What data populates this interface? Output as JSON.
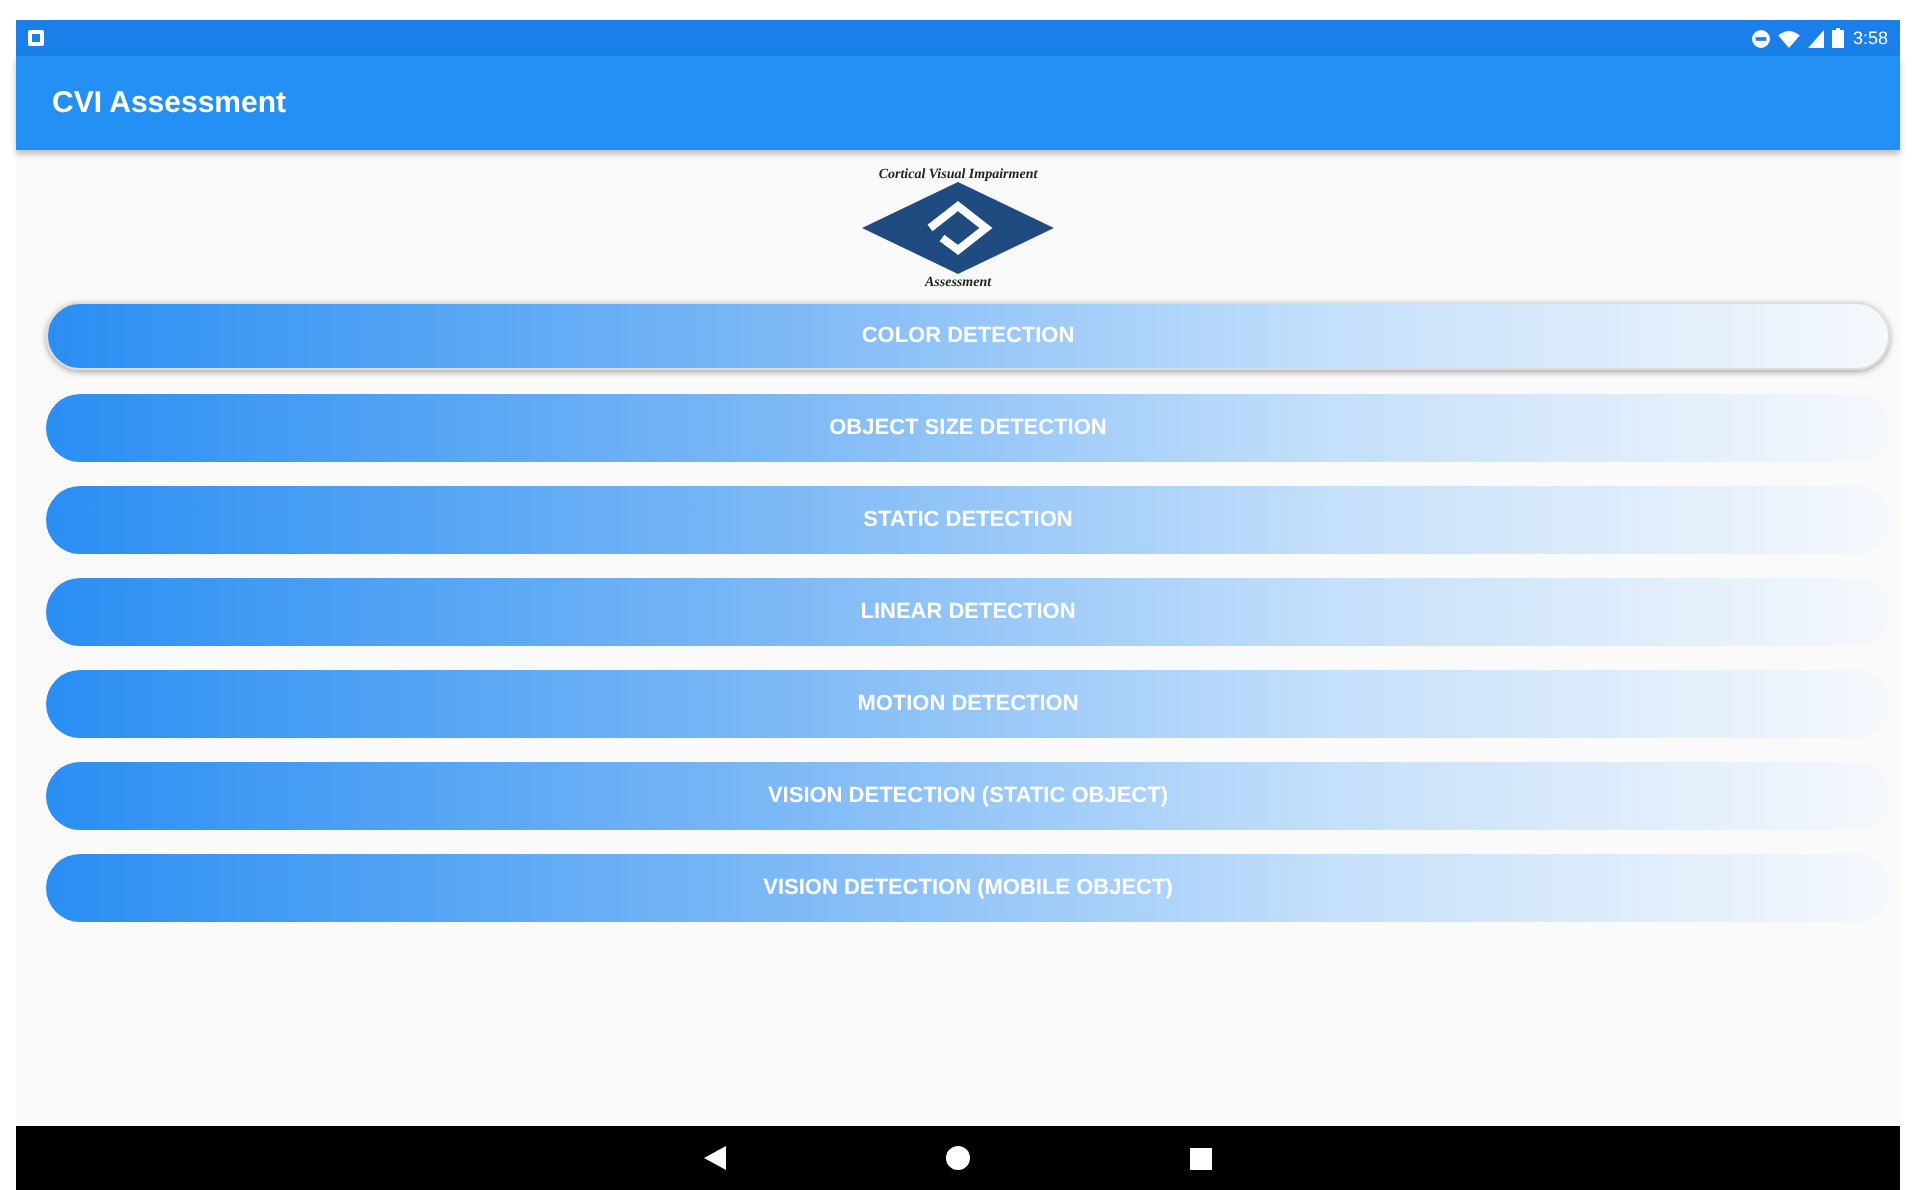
{
  "status_bar": {
    "time": "3:58"
  },
  "app_bar": {
    "title": "CVI Assessment"
  },
  "logo": {
    "top_text": "Cortical Visual Impairment",
    "bottom_text": "Assessment"
  },
  "buttons": [
    {
      "label": "COLOR DETECTION",
      "selected": true
    },
    {
      "label": "OBJECT SIZE DETECTION",
      "selected": false
    },
    {
      "label": "STATIC DETECTION",
      "selected": false
    },
    {
      "label": "LINEAR DETECTION",
      "selected": false
    },
    {
      "label": "MOTION DETECTION",
      "selected": false
    },
    {
      "label": "VISION DETECTION (STATIC OBJECT)",
      "selected": false
    },
    {
      "label": "VISION DETECTION (MOBILE OBJECT)",
      "selected": false
    }
  ]
}
